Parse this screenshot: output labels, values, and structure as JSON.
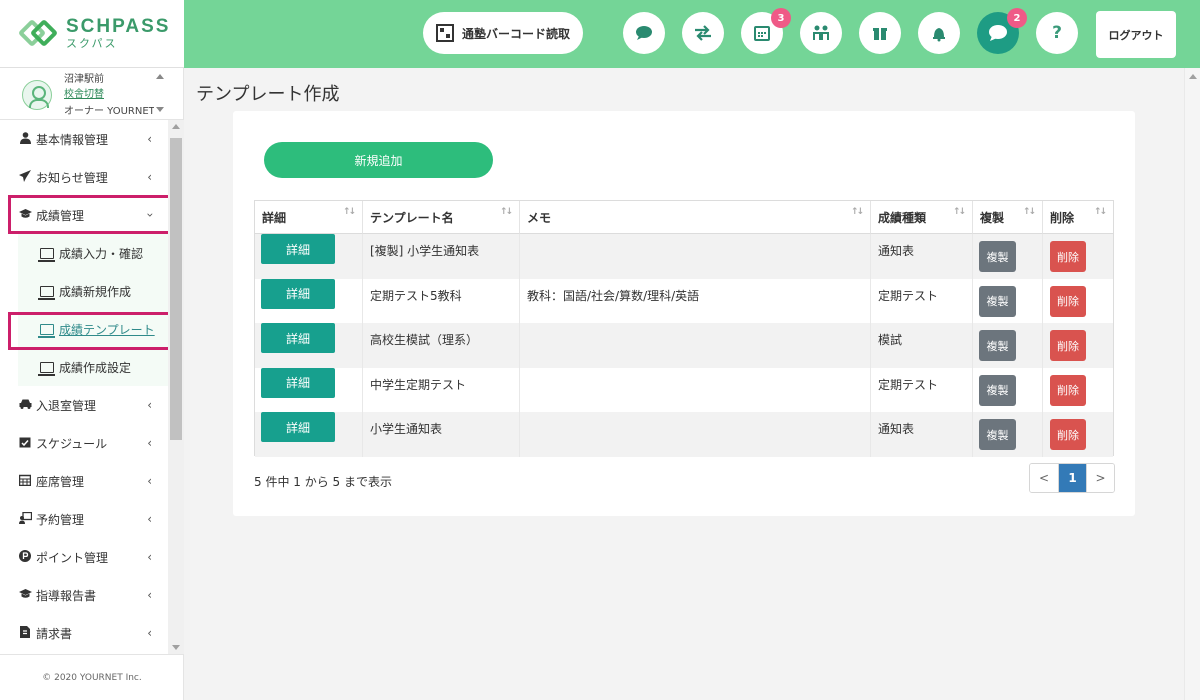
{
  "logo": {
    "main": "SCHPASS",
    "sub": "スクパス"
  },
  "header": {
    "barcode_label": "通塾バーコード読取",
    "calendar_badge": "3",
    "chat_badge": "2",
    "help_glyph": "?",
    "logout_label": "ログアウト",
    "icons": [
      "message-icon",
      "exchange-icon",
      "calendar-icon",
      "users-icon",
      "gift-icon",
      "bell-icon",
      "chat-icon",
      "help-icon"
    ]
  },
  "user": {
    "school": "沼津駅前",
    "switch_label": "校舎切替",
    "owner": "オーナー YOURNET"
  },
  "sidebar": {
    "items": [
      {
        "label": "基本情報管理",
        "icon": "user-icon"
      },
      {
        "label": "お知らせ管理",
        "icon": "paper-plane-icon"
      },
      {
        "label": "成績管理",
        "icon": "graduation-cap-icon"
      },
      {
        "label": "入退室管理",
        "icon": "car-icon"
      },
      {
        "label": "スケジュール",
        "icon": "calendar-check-icon"
      },
      {
        "label": "座席管理",
        "icon": "grid-calendar-icon"
      },
      {
        "label": "予約管理",
        "icon": "user-board-icon"
      },
      {
        "label": "ポイント管理",
        "icon": "point-icon"
      },
      {
        "label": "指導報告書",
        "icon": "graduation-cap-icon"
      },
      {
        "label": "請求書",
        "icon": "invoice-icon"
      }
    ],
    "sub_items": [
      {
        "label": "成績入力・確認"
      },
      {
        "label": "成績新規作成"
      },
      {
        "label": "成績テンプレート"
      },
      {
        "label": "成績作成設定"
      }
    ],
    "copyright": "© 2020 YOURNET Inc."
  },
  "main": {
    "title": "テンプレート作成",
    "add_label": "新規追加",
    "columns": [
      "詳細",
      "テンプレート名",
      "メモ",
      "成績種類",
      "複製",
      "削除"
    ],
    "rows": [
      {
        "name": "[複製] 小学生通知表",
        "memo": "",
        "type": "通知表"
      },
      {
        "name": "定期テスト5教科",
        "memo": "教科：国語/社会/算数/理科/英語",
        "type": "定期テスト"
      },
      {
        "name": "高校生模試（理系）",
        "memo": "",
        "type": "模試"
      },
      {
        "name": "中学生定期テスト",
        "memo": "",
        "type": "定期テスト"
      },
      {
        "name": "小学生通知表",
        "memo": "",
        "type": "通知表"
      }
    ],
    "detail_label": "詳細",
    "copy_label": "複製",
    "delete_label": "削除",
    "info": "5 件中 1 から 5 まで表示",
    "pager": {
      "prev": "<",
      "current": "1",
      "next": ">"
    }
  }
}
